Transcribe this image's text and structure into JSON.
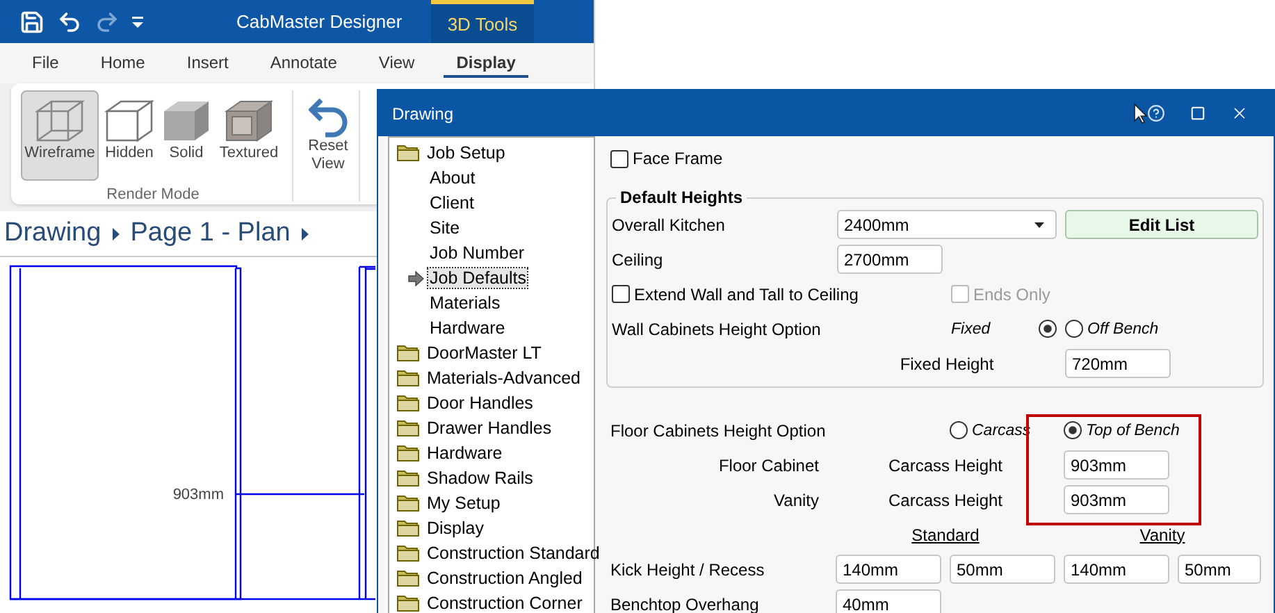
{
  "app": {
    "quick_access": [
      {
        "kind": "save",
        "disabled": false
      },
      {
        "kind": "undo",
        "disabled": false
      },
      {
        "kind": "redo",
        "disabled": true
      },
      {
        "kind": "customize",
        "disabled": false
      }
    ],
    "title": "CabMaster Designer",
    "context_tab": "3D Tools",
    "ribbon_tabs": [
      {
        "label": "File",
        "selected": false
      },
      {
        "label": "Home",
        "selected": false
      },
      {
        "label": "Insert",
        "selected": false
      },
      {
        "label": "Annotate",
        "selected": false
      },
      {
        "label": "View",
        "selected": false
      },
      {
        "label": "Display",
        "selected": true
      }
    ],
    "ribbon_groups": [
      {
        "label": "Render Mode",
        "buttons": [
          {
            "label": "Wireframe",
            "kind": "wireframe",
            "selected": true
          },
          {
            "label": "Hidden",
            "kind": "hidden",
            "selected": false
          },
          {
            "label": "Solid",
            "kind": "solid",
            "selected": false
          },
          {
            "label": "Textured",
            "kind": "textured",
            "selected": false
          }
        ]
      },
      {
        "buttons": [
          {
            "label": "Reset View",
            "kind": "reset",
            "selected": false
          }
        ]
      }
    ],
    "breadcrumb": [
      "Drawing",
      "Page 1 - Plan"
    ],
    "canvas": {
      "dimension_label": "903mm"
    }
  },
  "dialog": {
    "title": "Drawing",
    "tree": [
      {
        "label": "Job Setup",
        "selected": false,
        "children": [
          {
            "label": "About",
            "selected": false
          },
          {
            "label": "Client",
            "selected": false
          },
          {
            "label": "Site",
            "selected": false
          },
          {
            "label": "Job Number",
            "selected": false
          },
          {
            "label": "Job Defaults",
            "selected": true
          },
          {
            "label": "Materials",
            "selected": false
          },
          {
            "label": "Hardware",
            "selected": false
          }
        ]
      },
      {
        "label": "DoorMaster LT",
        "selected": false
      },
      {
        "label": "Materials-Advanced",
        "selected": false
      },
      {
        "label": "Door Handles",
        "selected": false
      },
      {
        "label": "Drawer Handles",
        "selected": false
      },
      {
        "label": "Hardware",
        "selected": false
      },
      {
        "label": "Shadow Rails",
        "selected": false
      },
      {
        "label": "My Setup",
        "selected": false
      },
      {
        "label": "Display",
        "selected": false
      },
      {
        "label": "Construction Standard",
        "selected": false
      },
      {
        "label": "Construction Angled",
        "selected": false
      },
      {
        "label": "Construction Corner",
        "selected": false
      }
    ],
    "face_frame": {
      "label": "Face Frame",
      "checked": false
    },
    "default_heights": {
      "title": "Default Heights",
      "overall_kitchen": {
        "label": "Overall Kitchen",
        "value": "2400mm"
      },
      "edit_list_button": "Edit List",
      "ceiling": {
        "label": "Ceiling",
        "value": "2700mm"
      },
      "extend_to_ceiling": {
        "label": "Extend Wall and Tall to Ceiling",
        "checked": false
      },
      "ends_only": {
        "label": "Ends Only",
        "checked": false,
        "disabled": true
      },
      "wall_option": {
        "label": "Wall Cabinets Height Option",
        "options": [
          {
            "label": "Fixed",
            "selected": true
          },
          {
            "label": "Off Bench",
            "selected": false
          }
        ]
      },
      "fixed_height": {
        "label": "Fixed Height",
        "value": "720mm"
      }
    },
    "floor_option": {
      "label": "Floor Cabinets Height Option",
      "options": [
        {
          "label": "Carcass",
          "selected": false
        },
        {
          "label": "Top of Bench",
          "selected": true
        }
      ]
    },
    "carcass_rows": [
      {
        "label": "Floor Cabinet",
        "sublabel": "Carcass Height",
        "value": "903mm"
      },
      {
        "label": "Vanity",
        "sublabel": "Carcass Height",
        "value": "903mm"
      }
    ],
    "column_headers": [
      "Standard",
      "Vanity"
    ],
    "kick_row": {
      "label": "Kick Height / Recess",
      "values": [
        "140mm",
        "50mm",
        "140mm",
        "50mm"
      ]
    },
    "benchtop_row": {
      "label": "Benchtop Overhang",
      "values": [
        "40mm"
      ]
    }
  }
}
